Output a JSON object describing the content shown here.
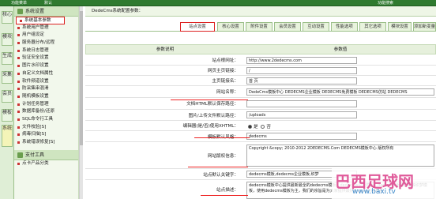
{
  "topbar": {
    "left_a": "功能菜单",
    "left_b": "默认",
    "right": "功能搜索"
  },
  "lefttabs": [
    "核心",
    "模块",
    "生成",
    "采集",
    "会员",
    "模板",
    "系统"
  ],
  "menu": {
    "header": "系统设置",
    "items": [
      "系统基本参数",
      "系统用户管理",
      "用户组设定",
      "服务器分布/远程",
      "系统日志管理",
      "验证安全设置",
      "图片水印设置",
      "自定义文档属性",
      "软件频道设置",
      "防采集串混淆",
      "随机模板设置",
      "计划任务管理",
      "数据库备份/还原",
      "SQL命令行工具",
      "文件校验[S]",
      "病毒扫描[S]",
      "系统错误修复[S]"
    ],
    "footer": "支付工具",
    "footer_item": "点卡产品分类"
  },
  "main": {
    "title": "DedeCms系统配置参数：",
    "tabs": [
      "站点设置",
      "核心设置",
      "附件设置",
      "会员设置",
      "互动设置",
      "性能选项",
      "其它选项",
      "模块设置",
      "添加新变量"
    ],
    "col_label": "参数说明",
    "col_value": "参数值",
    "rows": [
      {
        "label": "站点根网址：",
        "value": "http://www.2dedecms.com"
      },
      {
        "label": "网页主页链接：",
        "value": "/"
      },
      {
        "label": "主页链接名：",
        "value": "首 页"
      },
      {
        "label": "网站名称：",
        "value": "DedeCms模板中心 DEDECMS企业模板 DEDECMS免费模板 DEDECMS仿站 DEDECMS"
      },
      {
        "label": "文档HTML默认保存路径：",
        "value": ""
      },
      {
        "label": "图片/上传文件默认路径：",
        "value": "/uploads"
      },
      {
        "label": "编辑器(是/否)使用XHTML：",
        "value": "是",
        "value2": "否"
      },
      {
        "label": "模板默认风格：",
        "value": "dedecms"
      },
      {
        "label": "网站版权信息：",
        "value": "Copyright &copy; 2010-2012 2DEDECMS.Com DEDECMS模板中心 版权所有"
      },
      {
        "label": "站点默认关键字：",
        "value": "dedecms模板,dedecms企业模板,织梦"
      },
      {
        "label": "站点描述：",
        "value": "dedecms模板中心提供最新最全的dedecms模板、dedecms企业模板、dedecms免费模板等织梦模板，使用dedecms模板为主，我们的宗旨是为大家提供最好的dedecms模板"
      }
    ]
  },
  "watermark": {
    "line1": "巴西足球网",
    "line2": "www.baxi.tv"
  }
}
